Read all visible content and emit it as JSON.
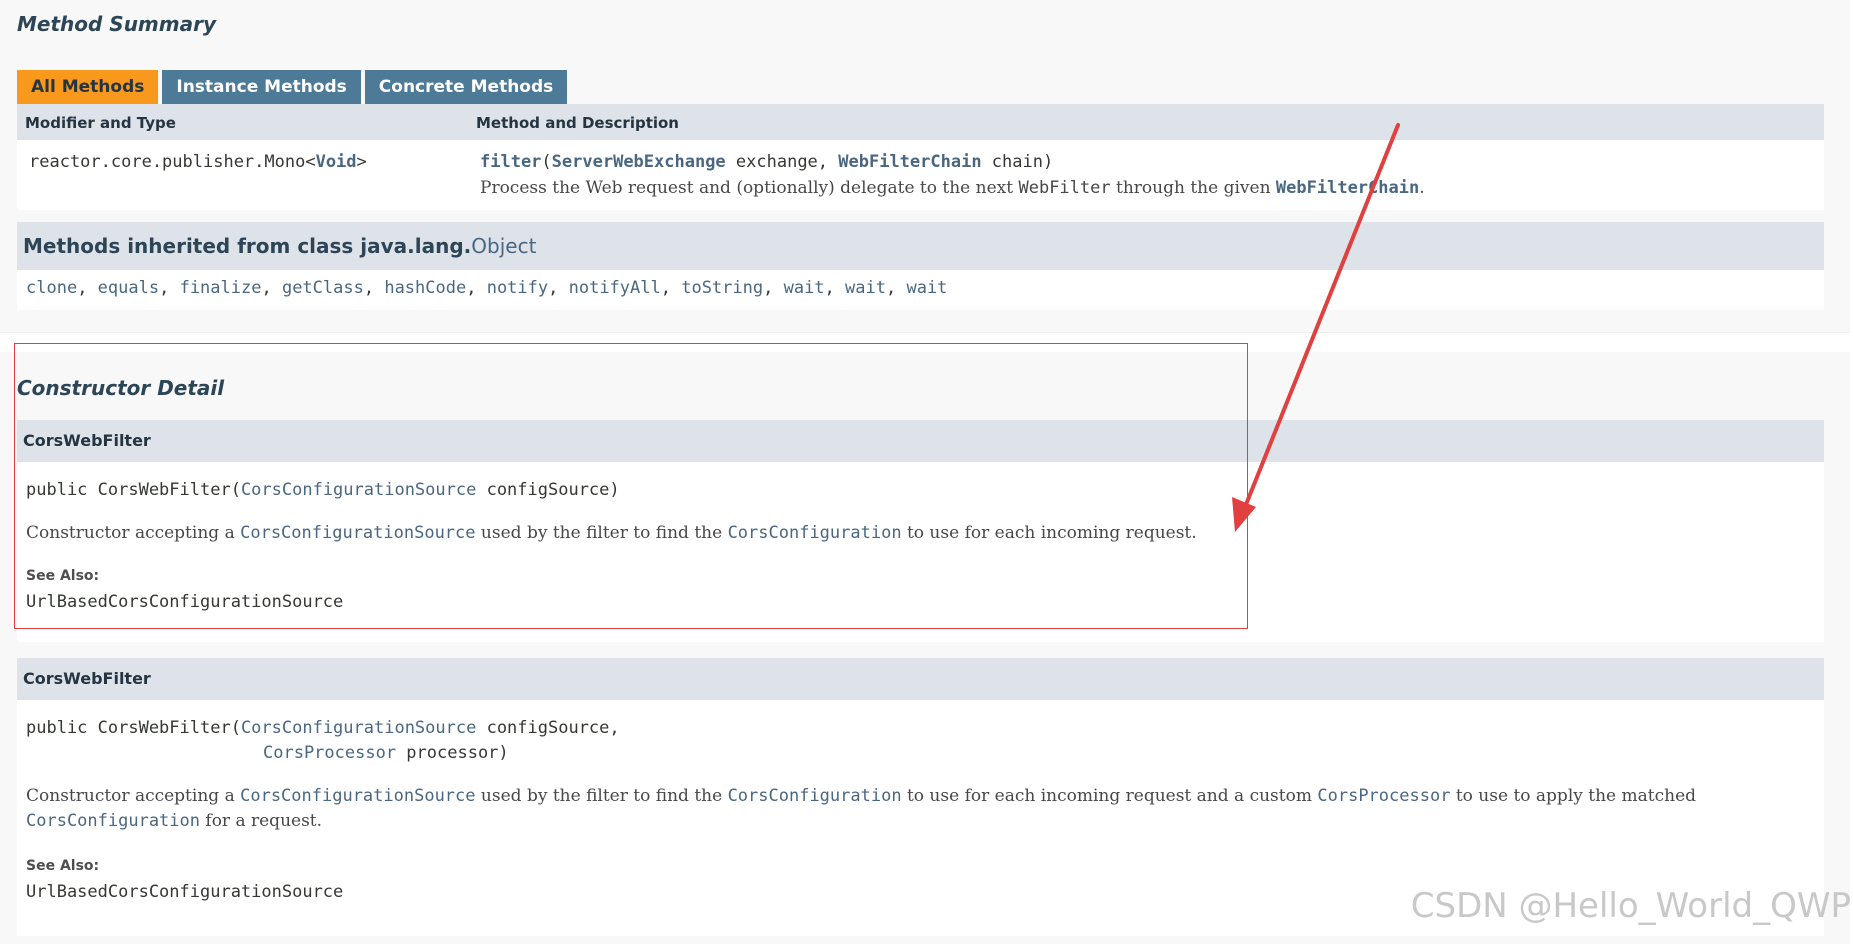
{
  "method_summary": {
    "title": "Method Summary",
    "tabs": [
      {
        "label": "All Methods",
        "active": true
      },
      {
        "label": "Instance Methods",
        "active": false
      },
      {
        "label": "Concrete Methods",
        "active": false
      }
    ],
    "columns": [
      "Modifier and Type",
      "Method and Description"
    ],
    "row": {
      "type": "reactor.core.publisher.Mono<",
      "type_link": "Void",
      "type_end": ">",
      "method_name": "filter",
      "p1_type": "ServerWebExchange",
      "p1_name": " exchange, ",
      "p2_type": "WebFilterChain",
      "p2_name": " chain)",
      "desc_prefix": "Process the Web request and (optionally) delegate to the next ",
      "desc_code1": "WebFilter",
      "desc_mid": " through the given ",
      "desc_link": "WebFilterChain",
      "desc_end": "."
    }
  },
  "inherited": {
    "prefix": "Methods inherited from class java.lang.",
    "class_link": "Object",
    "methods": [
      "clone",
      "equals",
      "finalize",
      "getClass",
      "hashCode",
      "notify",
      "notifyAll",
      "toString",
      "wait",
      "wait",
      "wait"
    ]
  },
  "constructor_detail": {
    "title": "Constructor Detail",
    "ctor1": {
      "name": "CorsWebFilter",
      "sig_prefix": "public CorsWebFilter(",
      "p1_type": "CorsConfigurationSource",
      "p1_name": " configSource)",
      "desc_prefix": "Constructor accepting a ",
      "desc_link1": "CorsConfigurationSource",
      "desc_mid": " used by the filter to find the ",
      "desc_link2": "CorsConfiguration",
      "desc_end": " to use for each incoming request.",
      "see_also_label": "See Also:",
      "see_also_link": "UrlBasedCorsConfigurationSource"
    },
    "ctor2": {
      "name": "CorsWebFilter",
      "sig_prefix": "public CorsWebFilter(",
      "p1_type": "CorsConfigurationSource",
      "p1_name": " configSource,",
      "p2_type": "CorsProcessor",
      "p2_name": " processor)",
      "desc_prefix": "Constructor accepting a ",
      "desc_link1": "CorsConfigurationSource",
      "desc_mid1": " used by the filter to find the ",
      "desc_link2": "CorsConfiguration",
      "desc_mid2": " to use for each incoming request and a custom ",
      "desc_link3": "CorsProcessor",
      "desc_mid3": " to use to apply the matched ",
      "desc_link4": "CorsConfiguration",
      "desc_end": " for a request.",
      "see_also_label": "See Also:",
      "see_also_link": "UrlBasedCorsConfigurationSource"
    }
  },
  "watermark": "CSDN @Hello_World_QWP",
  "colors": {
    "link": "#4a6782",
    "tab_active": "#f8981d",
    "tab_inactive": "#4d7a97",
    "header_bg": "#dee3e9",
    "annotation_red": "#e04040"
  }
}
